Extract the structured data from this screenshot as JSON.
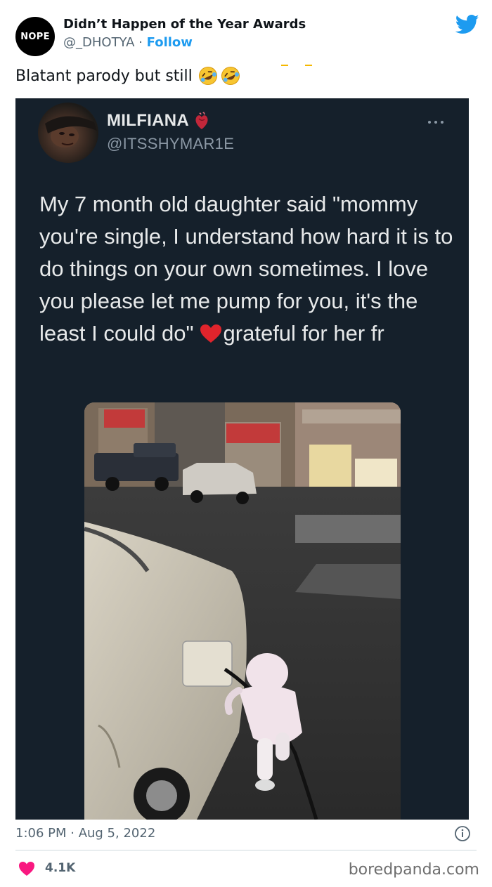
{
  "tweet": {
    "author_name": "Didn’t Happen of the Year Awards",
    "handle": "@_DHOTYA",
    "separator": " · ",
    "follow_label": "Follow",
    "avatar_text": "NOPE",
    "caption": "Blatant parody but still",
    "caption_emoji": "rolling-on-floor-laughing-emoji",
    "timestamp": "1:06 PM · Aug 5, 2022",
    "likes": "4.1K"
  },
  "embedded": {
    "display_name": "MILFIANA",
    "handle": "@ITSSHYMAR1E",
    "text_part1": "My 7 month old daughter said \"mommy you're single, I understand how hard it is to do things on your own sometimes. I love you please let me pump for you, it's the least I could do\"",
    "text_part2": "grateful for her fr",
    "photo_desc_icon": "gas-station-photo"
  },
  "icons": {
    "twitter": "twitter-bird-icon",
    "info": "info-icon",
    "like": "heart-icon",
    "more": "more-icon"
  },
  "colors": {
    "twitter_blue": "#1d9bf0",
    "embed_bg": "#15202b",
    "like_red": "#f91880"
  },
  "watermark": "boredpanda.com"
}
